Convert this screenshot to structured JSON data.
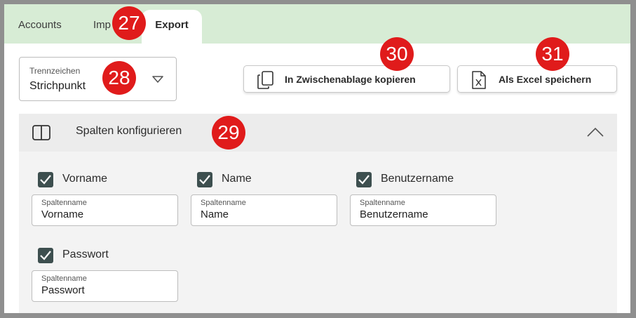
{
  "tabs": {
    "accounts": "Accounts",
    "import": "Imp",
    "export": "Export"
  },
  "badges": {
    "b27": "27",
    "b28": "28",
    "b29": "29",
    "b30": "30",
    "b31": "31"
  },
  "separator": {
    "label": "Trennzeichen",
    "value": "Strichpunkt"
  },
  "toolbar": {
    "copy_label": "In Zwischenablage kopieren",
    "excel_label": "Als Excel speichern"
  },
  "columns_panel": {
    "title": "Spalten konfigurieren",
    "field_label": "Spaltenname",
    "items": [
      {
        "label": "Vorname",
        "value": "Vorname",
        "checked": true
      },
      {
        "label": "Name",
        "value": "Name",
        "checked": true
      },
      {
        "label": "Benutzername",
        "value": "Benutzername",
        "checked": true
      },
      {
        "label": "Passwort",
        "value": "Passwort",
        "checked": true
      }
    ]
  },
  "colors": {
    "tab_bar": "#d7ecd5",
    "badge": "#e01b1b",
    "checkbox": "#3d4f4f"
  },
  "icons": {
    "select": "triangle-down-icon",
    "copy": "copy-icon",
    "excel": "excel-file-icon",
    "panel": "columns-icon",
    "collapse": "chevron-up-icon",
    "check": "checkmark-icon"
  }
}
